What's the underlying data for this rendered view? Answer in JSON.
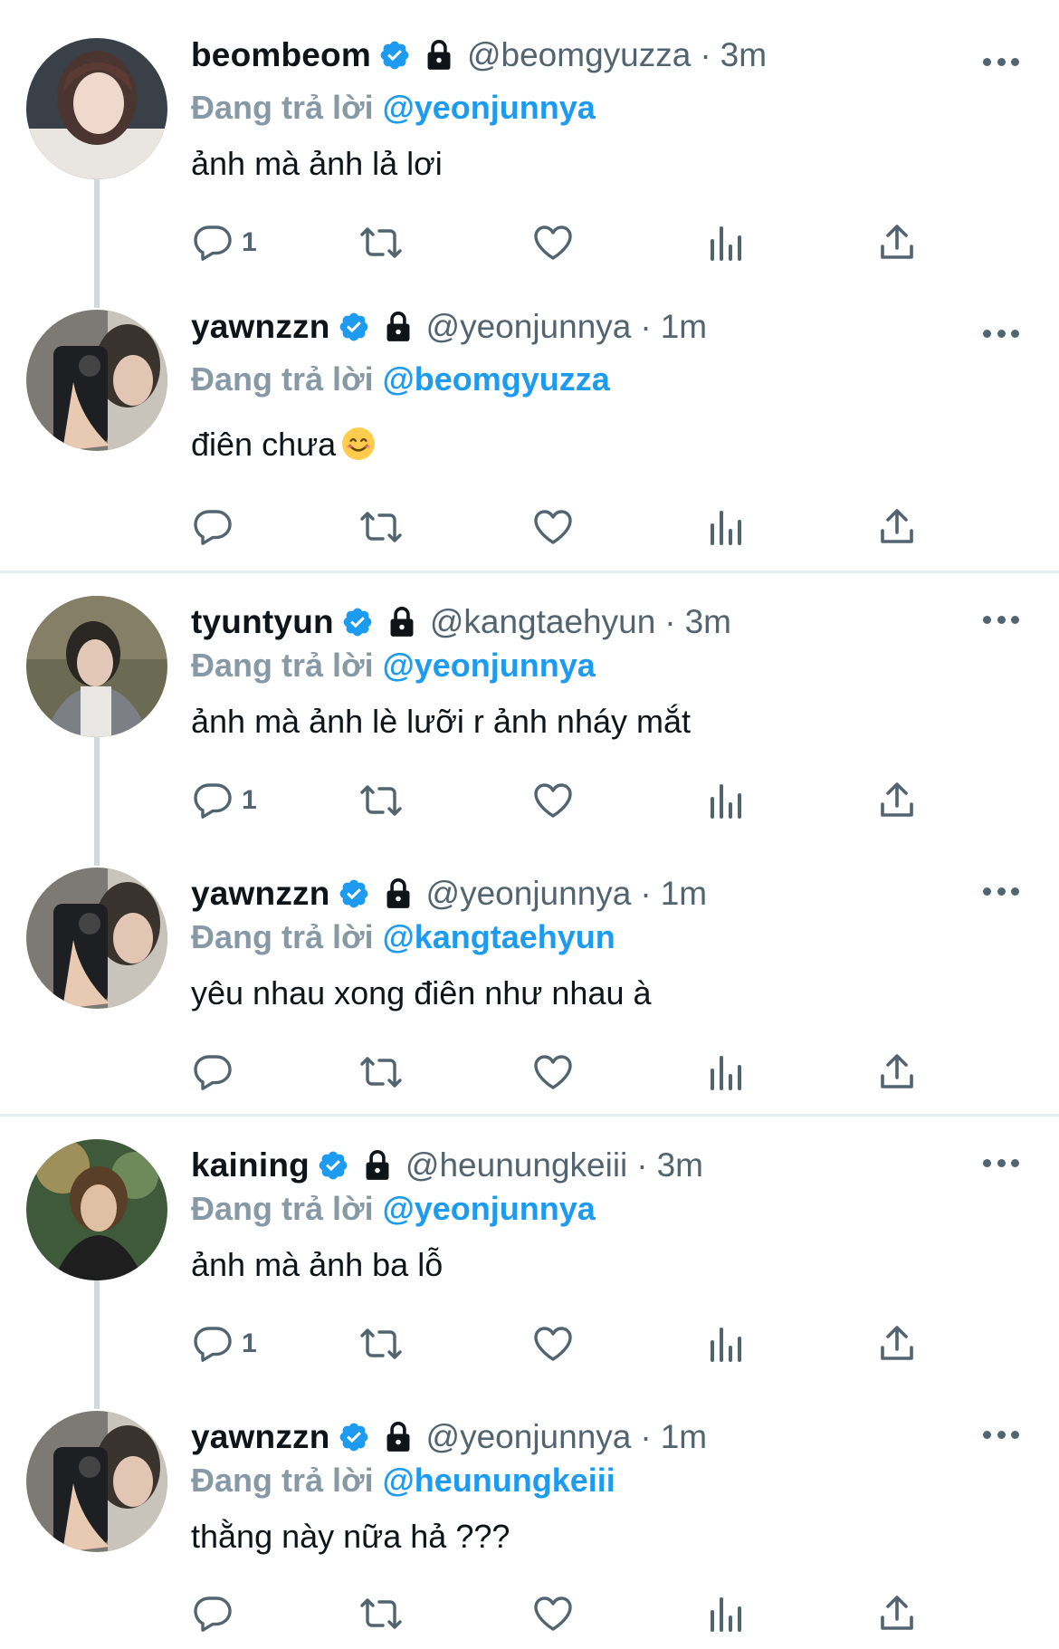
{
  "reply_prefix": "Đang trả lời",
  "tweets": [
    {
      "display_name": "beombeom",
      "handle": "@beomgyuzza",
      "sep": "·",
      "time": "3m",
      "reply_to": "@yeonjunnya",
      "text": "ảnh mà ảnh lả lơi",
      "reply_count": "1"
    },
    {
      "display_name": "yawnzzn",
      "handle": "@yeonjunnya",
      "sep": "·",
      "time": "1m",
      "reply_to": "@beomgyuzza",
      "text": "điên chưa",
      "emoji": "smiling-face-emoji",
      "reply_count": ""
    },
    {
      "display_name": "tyuntyun",
      "handle": "@kangtaehyun",
      "sep": "·",
      "time": "3m",
      "reply_to": "@yeonjunnya",
      "text": "ảnh mà ảnh lè lưỡi r ảnh nháy mắt",
      "reply_count": "1"
    },
    {
      "display_name": "yawnzzn",
      "handle": "@yeonjunnya",
      "sep": "·",
      "time": "1m",
      "reply_to": "@kangtaehyun",
      "text": "yêu nhau xong điên như nhau à",
      "reply_count": ""
    },
    {
      "display_name": "kaining",
      "handle": "@heunungkeiii",
      "sep": "·",
      "time": "3m",
      "reply_to": "@yeonjunnya",
      "text": "ảnh mà ảnh ba lỗ",
      "reply_count": "1"
    },
    {
      "display_name": "yawnzzn",
      "handle": "@yeonjunnya",
      "sep": "·",
      "time": "1m",
      "reply_to": "@heunungkeiii",
      "text": "thằng này nữa hả ???",
      "reply_count": ""
    }
  ],
  "colors": {
    "accent": "#1d9bf0",
    "secondary_text": "#536471",
    "reply_label": "#8899a6",
    "divider": "#e6ecf0"
  }
}
